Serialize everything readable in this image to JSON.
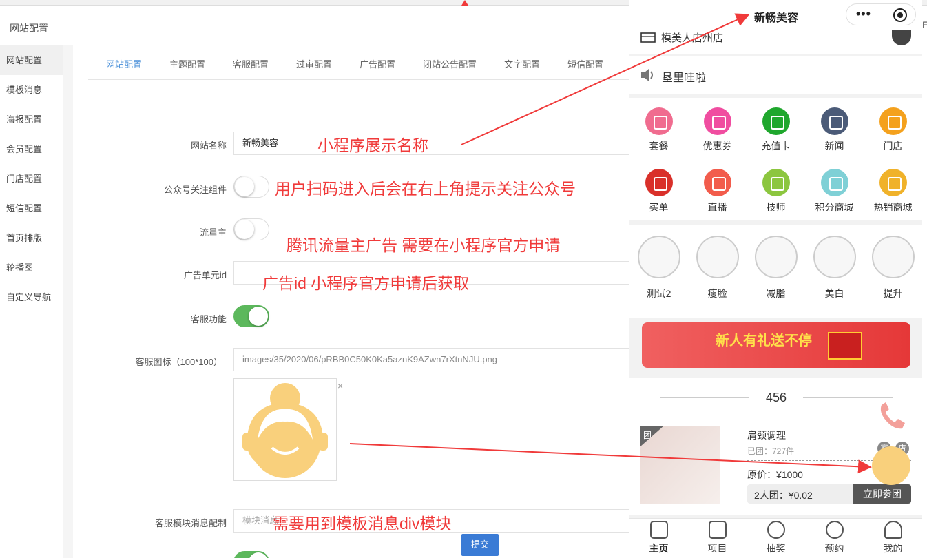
{
  "admin": {
    "header": "网站配置",
    "sidebar": [
      "网站配置",
      "模板消息",
      "海报配置",
      "会员配置",
      "门店配置",
      "短信配置",
      "首页排版",
      "轮播图",
      "自定义导航"
    ],
    "tabs": [
      "网站配置",
      "主题配置",
      "客服配置",
      "过审配置",
      "广告配置",
      "闭站公告配置",
      "文字配置",
      "短信配置"
    ],
    "form": {
      "site_name_label": "网站名称",
      "site_name_value": "新畅美容",
      "follow_label": "公众号关注组件",
      "traffic_label": "流量主",
      "ad_unit_label": "广告单元id",
      "cs_func_label": "客服功能",
      "cs_icon_label": "客服图标（100*100）",
      "cs_icon_path": "images/35/2020/06/pRBB0C50K0Ka5aznK9AZwn7rXtnNJU.png",
      "cs_msg_label": "客服模块消息配制",
      "cs_msg_placeholder": "模块消息",
      "submit": "提交",
      "close": "×"
    }
  },
  "annotations": {
    "a1": "小程序展示名称",
    "a2": "用户扫码进入后会在右上角提示关注公众号",
    "a3": "腾讯流量主广告 需要在小程序官方申请",
    "a4": "广告id 小程序官方申请后获取",
    "a5": "需要用到模板消息div模块",
    "color": "#f03a3a"
  },
  "phone": {
    "title": "新畅美容",
    "capsule_dots": "•••",
    "store_text": "模美人店州店",
    "notice": "垦里哇啦",
    "grid": [
      {
        "label": "套餐",
        "color": "#f06c8f"
      },
      {
        "label": "优惠券",
        "color": "#f04da0"
      },
      {
        "label": "充值卡",
        "color": "#1fa72d"
      },
      {
        "label": "新闻",
        "color": "#4b5b78"
      },
      {
        "label": "门店",
        "color": "#f4a11d"
      },
      {
        "label": "买单",
        "color": "#d9302a"
      },
      {
        "label": "直播",
        "color": "#f25c4c"
      },
      {
        "label": "技师",
        "color": "#8cc63f"
      },
      {
        "label": "积分商城",
        "color": "#7fd0d6"
      },
      {
        "label": "热销商城",
        "color": "#f0b22a"
      }
    ],
    "categories": [
      "测试2",
      "瘦脸",
      "减脂",
      "美白",
      "提升"
    ],
    "banner": "新人有礼送不停",
    "section_number": "456",
    "product": {
      "badge": "团",
      "name": "肩颈调理",
      "sold": "已团：727件",
      "original": "原价：¥1000",
      "group_price": "2人团：¥0.02",
      "join": "立即参团",
      "tag1": "家",
      "tag2": "店"
    },
    "tabbar": [
      "主页",
      "项目",
      "抽奖",
      "预约",
      "我的"
    ]
  },
  "edge_glyph": "E"
}
